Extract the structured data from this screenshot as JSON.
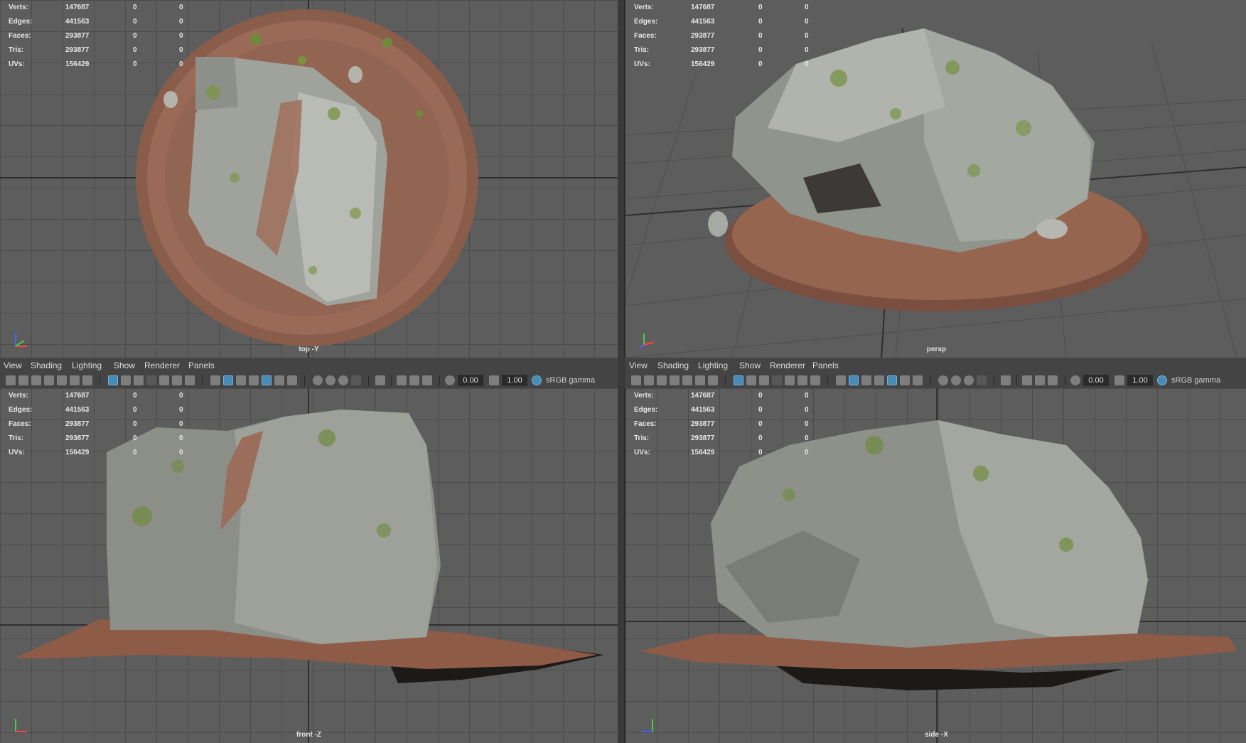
{
  "hud": {
    "rows": [
      {
        "label": "Verts:",
        "value": "147687",
        "sel": "0",
        "comp": "0"
      },
      {
        "label": "Edges:",
        "value": "441563",
        "sel": "0",
        "comp": "0"
      },
      {
        "label": "Faces:",
        "value": "293877",
        "sel": "0",
        "comp": "0"
      },
      {
        "label": "Tris:",
        "value": "293877",
        "sel": "0",
        "comp": "0"
      },
      {
        "label": "UVs:",
        "value": "156429",
        "sel": "0",
        "comp": "0"
      }
    ]
  },
  "viewports": {
    "top": {
      "camera": "top -Y"
    },
    "persp": {
      "camera": "persp"
    },
    "front": {
      "camera": "front -Z"
    },
    "side": {
      "camera": "side -X"
    }
  },
  "menubar": {
    "items": [
      "View",
      "Shading",
      "Lighting",
      "Show",
      "Renderer",
      "Panels"
    ]
  },
  "toolbar": {
    "exposure": "0.00",
    "gamma": "1.00",
    "color_space": "sRGB gamma"
  },
  "icons": {
    "axis_gizmo": "axis-gizmo-icon",
    "camera": "camera-icon",
    "wireframe": "wireframe-icon",
    "smooth_shade": "smooth-shade-icon",
    "textured": "textured-icon",
    "lights": "lights-icon",
    "xray": "xray-icon",
    "colorspace": "colorspace-icon"
  }
}
